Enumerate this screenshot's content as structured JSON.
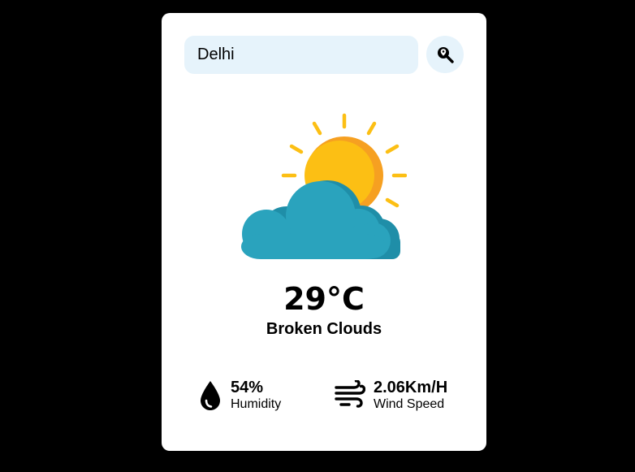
{
  "search": {
    "value": "Delhi",
    "placeholder": "",
    "button_icon": "search-location-icon"
  },
  "weather": {
    "icon": "sun-behind-cloud-icon",
    "temperature": "29°C",
    "description": "Broken Clouds"
  },
  "stats": {
    "humidity": {
      "icon": "water-drop-icon",
      "value": "54%",
      "label": "Humidity"
    },
    "wind": {
      "icon": "wind-icon",
      "value": "2.06Km/H",
      "label": "Wind Speed"
    }
  },
  "colors": {
    "background": "#000000",
    "card": "#ffffff",
    "input_bg": "#e6f3fb",
    "sun": "#fcbf14",
    "sun_shade": "#f6a021",
    "cloud": "#2aa3bd",
    "cloud_shade": "#1f8ea8"
  }
}
